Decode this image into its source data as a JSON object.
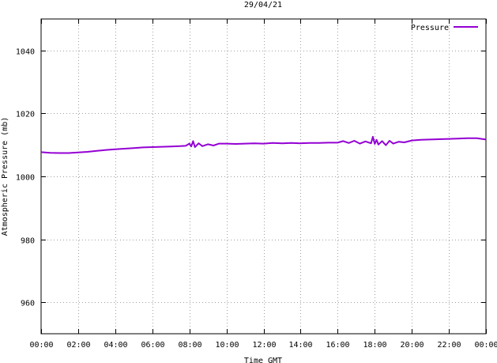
{
  "chart_data": {
    "type": "line",
    "title": "29/04/21",
    "xlabel": "Time GMT",
    "ylabel": "Atmospheric Pressure (mb)",
    "ylim": [
      950,
      1050
    ],
    "yticks": [
      960,
      980,
      1000,
      1020,
      1040
    ],
    "ytick_labels": [
      "960",
      "980",
      "1000",
      "1020",
      "1040"
    ],
    "xlim": [
      0,
      24
    ],
    "xtick_labels": [
      "00:00",
      "02:00",
      "04:00",
      "06:00",
      "08:00",
      "10:00",
      "12:00",
      "14:00",
      "16:00",
      "18:00",
      "20:00",
      "22:00",
      "00:00"
    ],
    "grid": true,
    "legend_position": "top-right",
    "series": [
      {
        "name": "Pressure",
        "color": "#9400d3",
        "x": [
          0,
          0.5,
          1,
          1.5,
          2,
          2.5,
          3,
          3.5,
          4,
          4.5,
          5,
          5.5,
          6,
          6.5,
          7,
          7.5,
          7.8,
          8,
          8.1,
          8.2,
          8.3,
          8.5,
          8.7,
          9,
          9.3,
          9.6,
          10,
          10.5,
          11,
          11.5,
          12,
          12.5,
          13,
          13.5,
          14,
          14.5,
          15,
          15.5,
          16,
          16.3,
          16.6,
          16.9,
          17.2,
          17.5,
          17.8,
          17.9,
          18,
          18.1,
          18.2,
          18.4,
          18.6,
          18.8,
          19,
          19.3,
          19.6,
          20,
          20.5,
          21,
          21.5,
          22,
          22.5,
          23,
          23.5,
          24
        ],
        "y": [
          1007.7,
          1007.5,
          1007.4,
          1007.4,
          1007.6,
          1007.8,
          1008.1,
          1008.4,
          1008.6,
          1008.8,
          1009.0,
          1009.2,
          1009.3,
          1009.4,
          1009.5,
          1009.6,
          1009.7,
          1010.4,
          1009.5,
          1011.2,
          1009.3,
          1010.5,
          1009.6,
          1010.2,
          1009.8,
          1010.4,
          1010.4,
          1010.3,
          1010.4,
          1010.5,
          1010.4,
          1010.6,
          1010.5,
          1010.6,
          1010.5,
          1010.6,
          1010.6,
          1010.7,
          1010.7,
          1011.2,
          1010.6,
          1011.3,
          1010.4,
          1011.1,
          1010.5,
          1012.6,
          1010.3,
          1011.6,
          1010.1,
          1011.2,
          1009.9,
          1011.3,
          1010.4,
          1011.0,
          1010.8,
          1011.4,
          1011.6,
          1011.7,
          1011.8,
          1011.9,
          1012.0,
          1012.1,
          1012.1,
          1011.7
        ]
      }
    ]
  }
}
